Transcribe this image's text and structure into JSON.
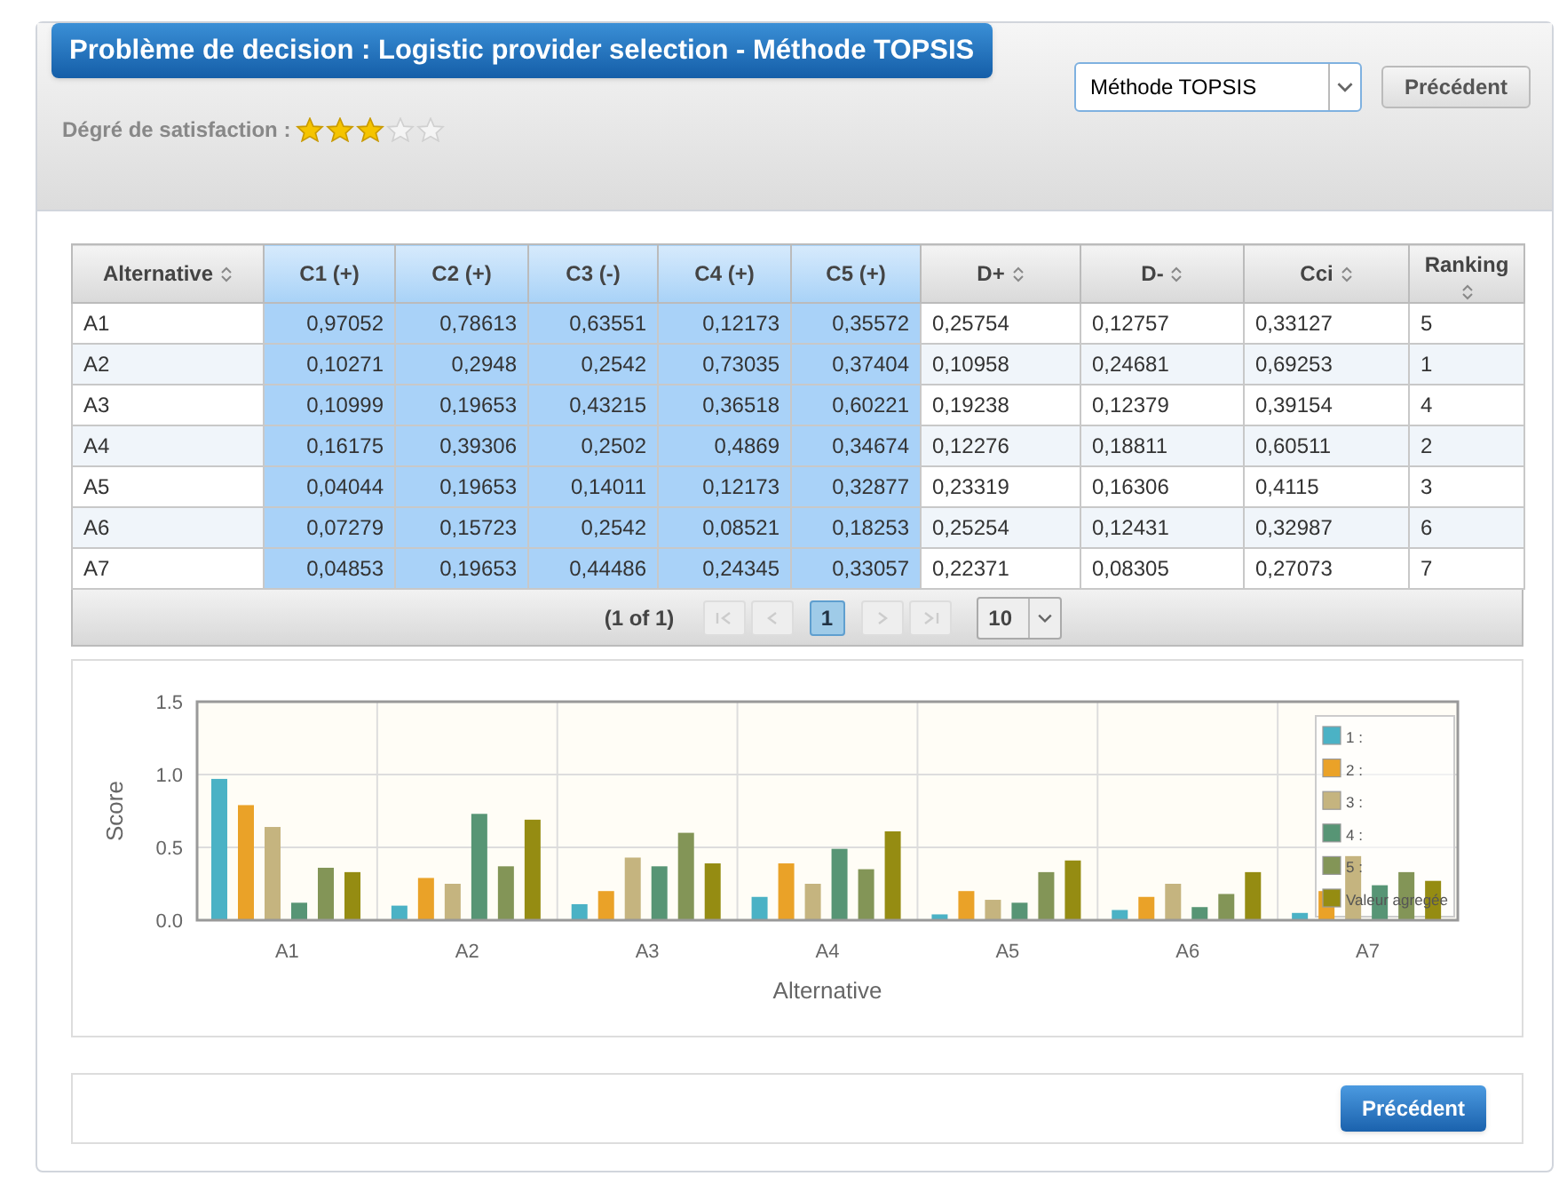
{
  "header": {
    "title": "Problème de decision : Logistic provider selection - Méthode TOPSIS",
    "satisfaction": {
      "label": "Dégré de satisfaction :",
      "stars": 3
    },
    "method_select": {
      "value": "Méthode TOPSIS"
    },
    "button": "Précédent"
  },
  "table": {
    "columns": [
      {
        "label": "Alternative",
        "sortable": true,
        "kind": "name"
      },
      {
        "label": "C1 (+)",
        "sortable": false,
        "kind": "criterion"
      },
      {
        "label": "C2 (+)",
        "sortable": false,
        "kind": "criterion"
      },
      {
        "label": "C3 (-)",
        "sortable": false,
        "kind": "criterion"
      },
      {
        "label": "C4 (+)",
        "sortable": false,
        "kind": "criterion"
      },
      {
        "label": "C5 (+)",
        "sortable": false,
        "kind": "criterion"
      },
      {
        "label": "D+",
        "sortable": true,
        "kind": "result"
      },
      {
        "label": "D-",
        "sortable": true,
        "kind": "result"
      },
      {
        "label": "Cci",
        "sortable": true,
        "kind": "result"
      },
      {
        "label": "Ranking",
        "sortable": true,
        "kind": "result"
      }
    ],
    "rows": [
      [
        "A1",
        "0,97052",
        "0,78613",
        "0,63551",
        "0,12173",
        "0,35572",
        "0,25754",
        "0,12757",
        "0,33127",
        "5"
      ],
      [
        "A2",
        "0,10271",
        "0,2948",
        "0,2542",
        "0,73035",
        "0,37404",
        "0,10958",
        "0,24681",
        "0,69253",
        "1"
      ],
      [
        "A3",
        "0,10999",
        "0,19653",
        "0,43215",
        "0,36518",
        "0,60221",
        "0,19238",
        "0,12379",
        "0,39154",
        "4"
      ],
      [
        "A4",
        "0,16175",
        "0,39306",
        "0,2502",
        "0,4869",
        "0,34674",
        "0,12276",
        "0,18811",
        "0,60511",
        "2"
      ],
      [
        "A5",
        "0,04044",
        "0,19653",
        "0,14011",
        "0,12173",
        "0,32877",
        "0,23319",
        "0,16306",
        "0,4115",
        "3"
      ],
      [
        "A6",
        "0,07279",
        "0,15723",
        "0,2542",
        "0,08521",
        "0,18253",
        "0,25254",
        "0,12431",
        "0,32987",
        "6"
      ],
      [
        "A7",
        "0,04853",
        "0,19653",
        "0,44486",
        "0,24345",
        "0,33057",
        "0,22371",
        "0,08305",
        "0,27073",
        "7"
      ]
    ],
    "paginator": {
      "summary": "(1 of 1)",
      "pages": [
        {
          "label": "1",
          "selected": true
        }
      ],
      "rows_per_page": "10"
    }
  },
  "chart": {
    "chart_data": {
      "type": "bar",
      "xlabel": "Alternative",
      "ylabel": "Score",
      "categories": [
        "A1",
        "A2",
        "A3",
        "A4",
        "A5",
        "A6",
        "A7"
      ],
      "legend": true,
      "ylim": [
        0,
        1.5
      ],
      "yticks": [
        {
          "value": 0,
          "label": "0.0"
        },
        {
          "value": 0.5,
          "label": "0.5"
        },
        {
          "value": 1,
          "label": "1.0"
        },
        {
          "value": 1.5,
          "label": "1.5"
        }
      ],
      "series": [
        {
          "name": "1 :",
          "color": "#4bb2c5",
          "values": [
            0.97,
            0.1,
            0.11,
            0.16,
            0.04,
            0.07,
            0.05
          ]
        },
        {
          "name": "2 :",
          "color": "#eaa228",
          "values": [
            0.79,
            0.29,
            0.2,
            0.39,
            0.2,
            0.16,
            0.2
          ]
        },
        {
          "name": "3 :",
          "color": "#c5b47f",
          "values": [
            0.64,
            0.25,
            0.43,
            0.25,
            0.14,
            0.25,
            0.44
          ]
        },
        {
          "name": "4 :",
          "color": "#579575",
          "values": [
            0.12,
            0.73,
            0.37,
            0.49,
            0.12,
            0.09,
            0.24
          ]
        },
        {
          "name": "5 :",
          "color": "#839557",
          "values": [
            0.36,
            0.37,
            0.6,
            0.35,
            0.33,
            0.18,
            0.33
          ]
        },
        {
          "name": "Valeur agregée",
          "color": "#958c12",
          "values": [
            0.33,
            0.69,
            0.39,
            0.61,
            0.41,
            0.33,
            0.27
          ]
        }
      ]
    }
  },
  "footer": {
    "button": "Précédent"
  }
}
